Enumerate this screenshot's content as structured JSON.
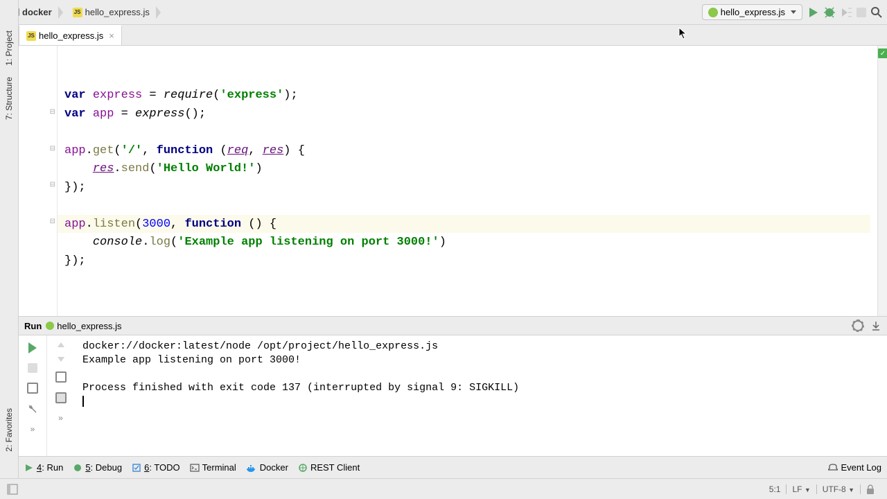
{
  "breadcrumb": {
    "project": "docker",
    "file": "hello_express.js"
  },
  "toolbar": {
    "run_config": "hello_express.js"
  },
  "tab": {
    "filename": "hello_express.js"
  },
  "left_rail": {
    "project": "1: Project",
    "structure": "7: Structure",
    "favorites": "2: Favorites"
  },
  "code": {
    "line1_var": "var",
    "line1_express": "express",
    "line1_require": "require",
    "line1_str": "'express'",
    "line2_var": "var",
    "line2_app": "app",
    "line2_express": "express",
    "line4_app": "app",
    "line4_get": "get",
    "line4_path": "'/'",
    "line4_function": "function",
    "line4_req": "req",
    "line4_res": "res",
    "line5_res": "res",
    "line5_send": "send",
    "line5_str": "'Hello World!'",
    "line8_app": "app",
    "line8_listen": "listen",
    "line8_port": "3000",
    "line8_function": "function",
    "line9_console": "console",
    "line9_log": "log",
    "line9_str": "'Example app listening on port 3000!'"
  },
  "run_panel": {
    "title": "Run",
    "config": "hello_express.js",
    "line1": "docker://docker:latest/node /opt/project/hello_express.js",
    "line2": "Example app listening on port 3000!",
    "line3": "",
    "line4": "Process finished with exit code 137 (interrupted by signal 9: SIGKILL)"
  },
  "bottom": {
    "run": "4: Run",
    "debug": "5: Debug",
    "todo": "6: TODO",
    "terminal": "Terminal",
    "docker": "Docker",
    "rest": "REST Client",
    "eventlog": "Event Log"
  },
  "status": {
    "pos": "5:1",
    "line_ending": "LF",
    "encoding": "UTF-8"
  }
}
